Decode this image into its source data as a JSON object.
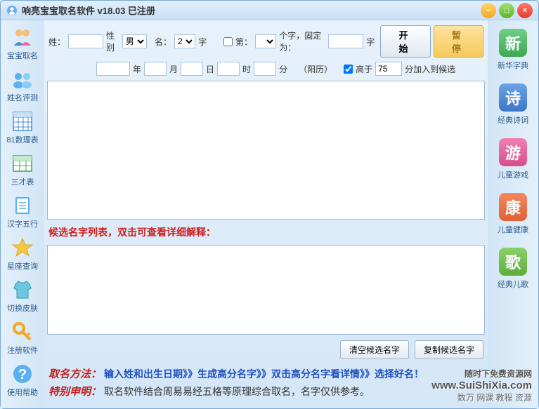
{
  "title": "响亮宝宝取名软件 v18.03  已注册",
  "titlebar_buttons": {
    "minimize": "−",
    "maximize": "□",
    "close": "×"
  },
  "form": {
    "surname_label": "姓：",
    "surname_value": "",
    "gender_label": "性别",
    "gender_selected": "男",
    "name_label": "名：",
    "name_chars": "2",
    "name_chars_suffix": "字",
    "fixed_label": "第：",
    "fixed_position": "",
    "fixed_suffix": "个字，固定为：",
    "fixed_value": "",
    "fixed_suffix2": "字",
    "start_button": "开 始",
    "pause_button": "暂 停",
    "year_label": "年",
    "month_label": "月",
    "day_label": "日",
    "hour_label": "时",
    "minute_label": "分",
    "calendar_label": "（阳历）",
    "score_label": "高于",
    "score_value": "75",
    "score_suffix": "分加入到候选"
  },
  "hint": "候选名字列表，双击可查看详细解释：",
  "bottom_buttons": {
    "clear": "清空候选名字",
    "copy": "复制候选名字"
  },
  "instructions": {
    "method_label": "取名方法：",
    "method_text": "输入姓和出生日期》》生成高分名字》》双击高分名字看详情》》选择好名！",
    "notice_label": "特别申明：",
    "notice_text": "取名软件结合周易易经五格等原理综合取名，名字仅供参考。"
  },
  "sidebar_left": [
    {
      "key": "baobao",
      "label": "宝宝取名",
      "icon": "people"
    },
    {
      "key": "pingce",
      "label": "姓名评测",
      "icon": "users"
    },
    {
      "key": "shuli",
      "label": "81数理表",
      "icon": "grid"
    },
    {
      "key": "sancai",
      "label": "三才表",
      "icon": "table"
    },
    {
      "key": "wuxing",
      "label": "汉字五行",
      "icon": "book"
    },
    {
      "key": "xingzuo",
      "label": "星座查询",
      "icon": "star"
    },
    {
      "key": "pifu",
      "label": "切换皮肤",
      "icon": "shirt"
    },
    {
      "key": "zhuce",
      "label": "注册软件",
      "icon": "key"
    },
    {
      "key": "bangzhu",
      "label": "使用帮助",
      "icon": "help"
    }
  ],
  "sidebar_right": [
    {
      "key": "zidian",
      "label": "新华字典",
      "char": "新",
      "color": "#3fa854"
    },
    {
      "key": "shici",
      "label": "经典诗词",
      "char": "诗",
      "color": "#3a77c8"
    },
    {
      "key": "youxi",
      "label": "儿童游戏",
      "char": "游",
      "color": "#d84e8e"
    },
    {
      "key": "jiankang",
      "label": "儿童健康",
      "char": "康",
      "color": "#e06036"
    },
    {
      "key": "erge",
      "label": "经典儿歌",
      "char": "歌",
      "color": "#5eae3c"
    }
  ],
  "watermark": {
    "main_prefix": "随时下免费资源网",
    "url": "www.SuiShiXia.com",
    "sub": "数万 网课 教程 资源"
  }
}
